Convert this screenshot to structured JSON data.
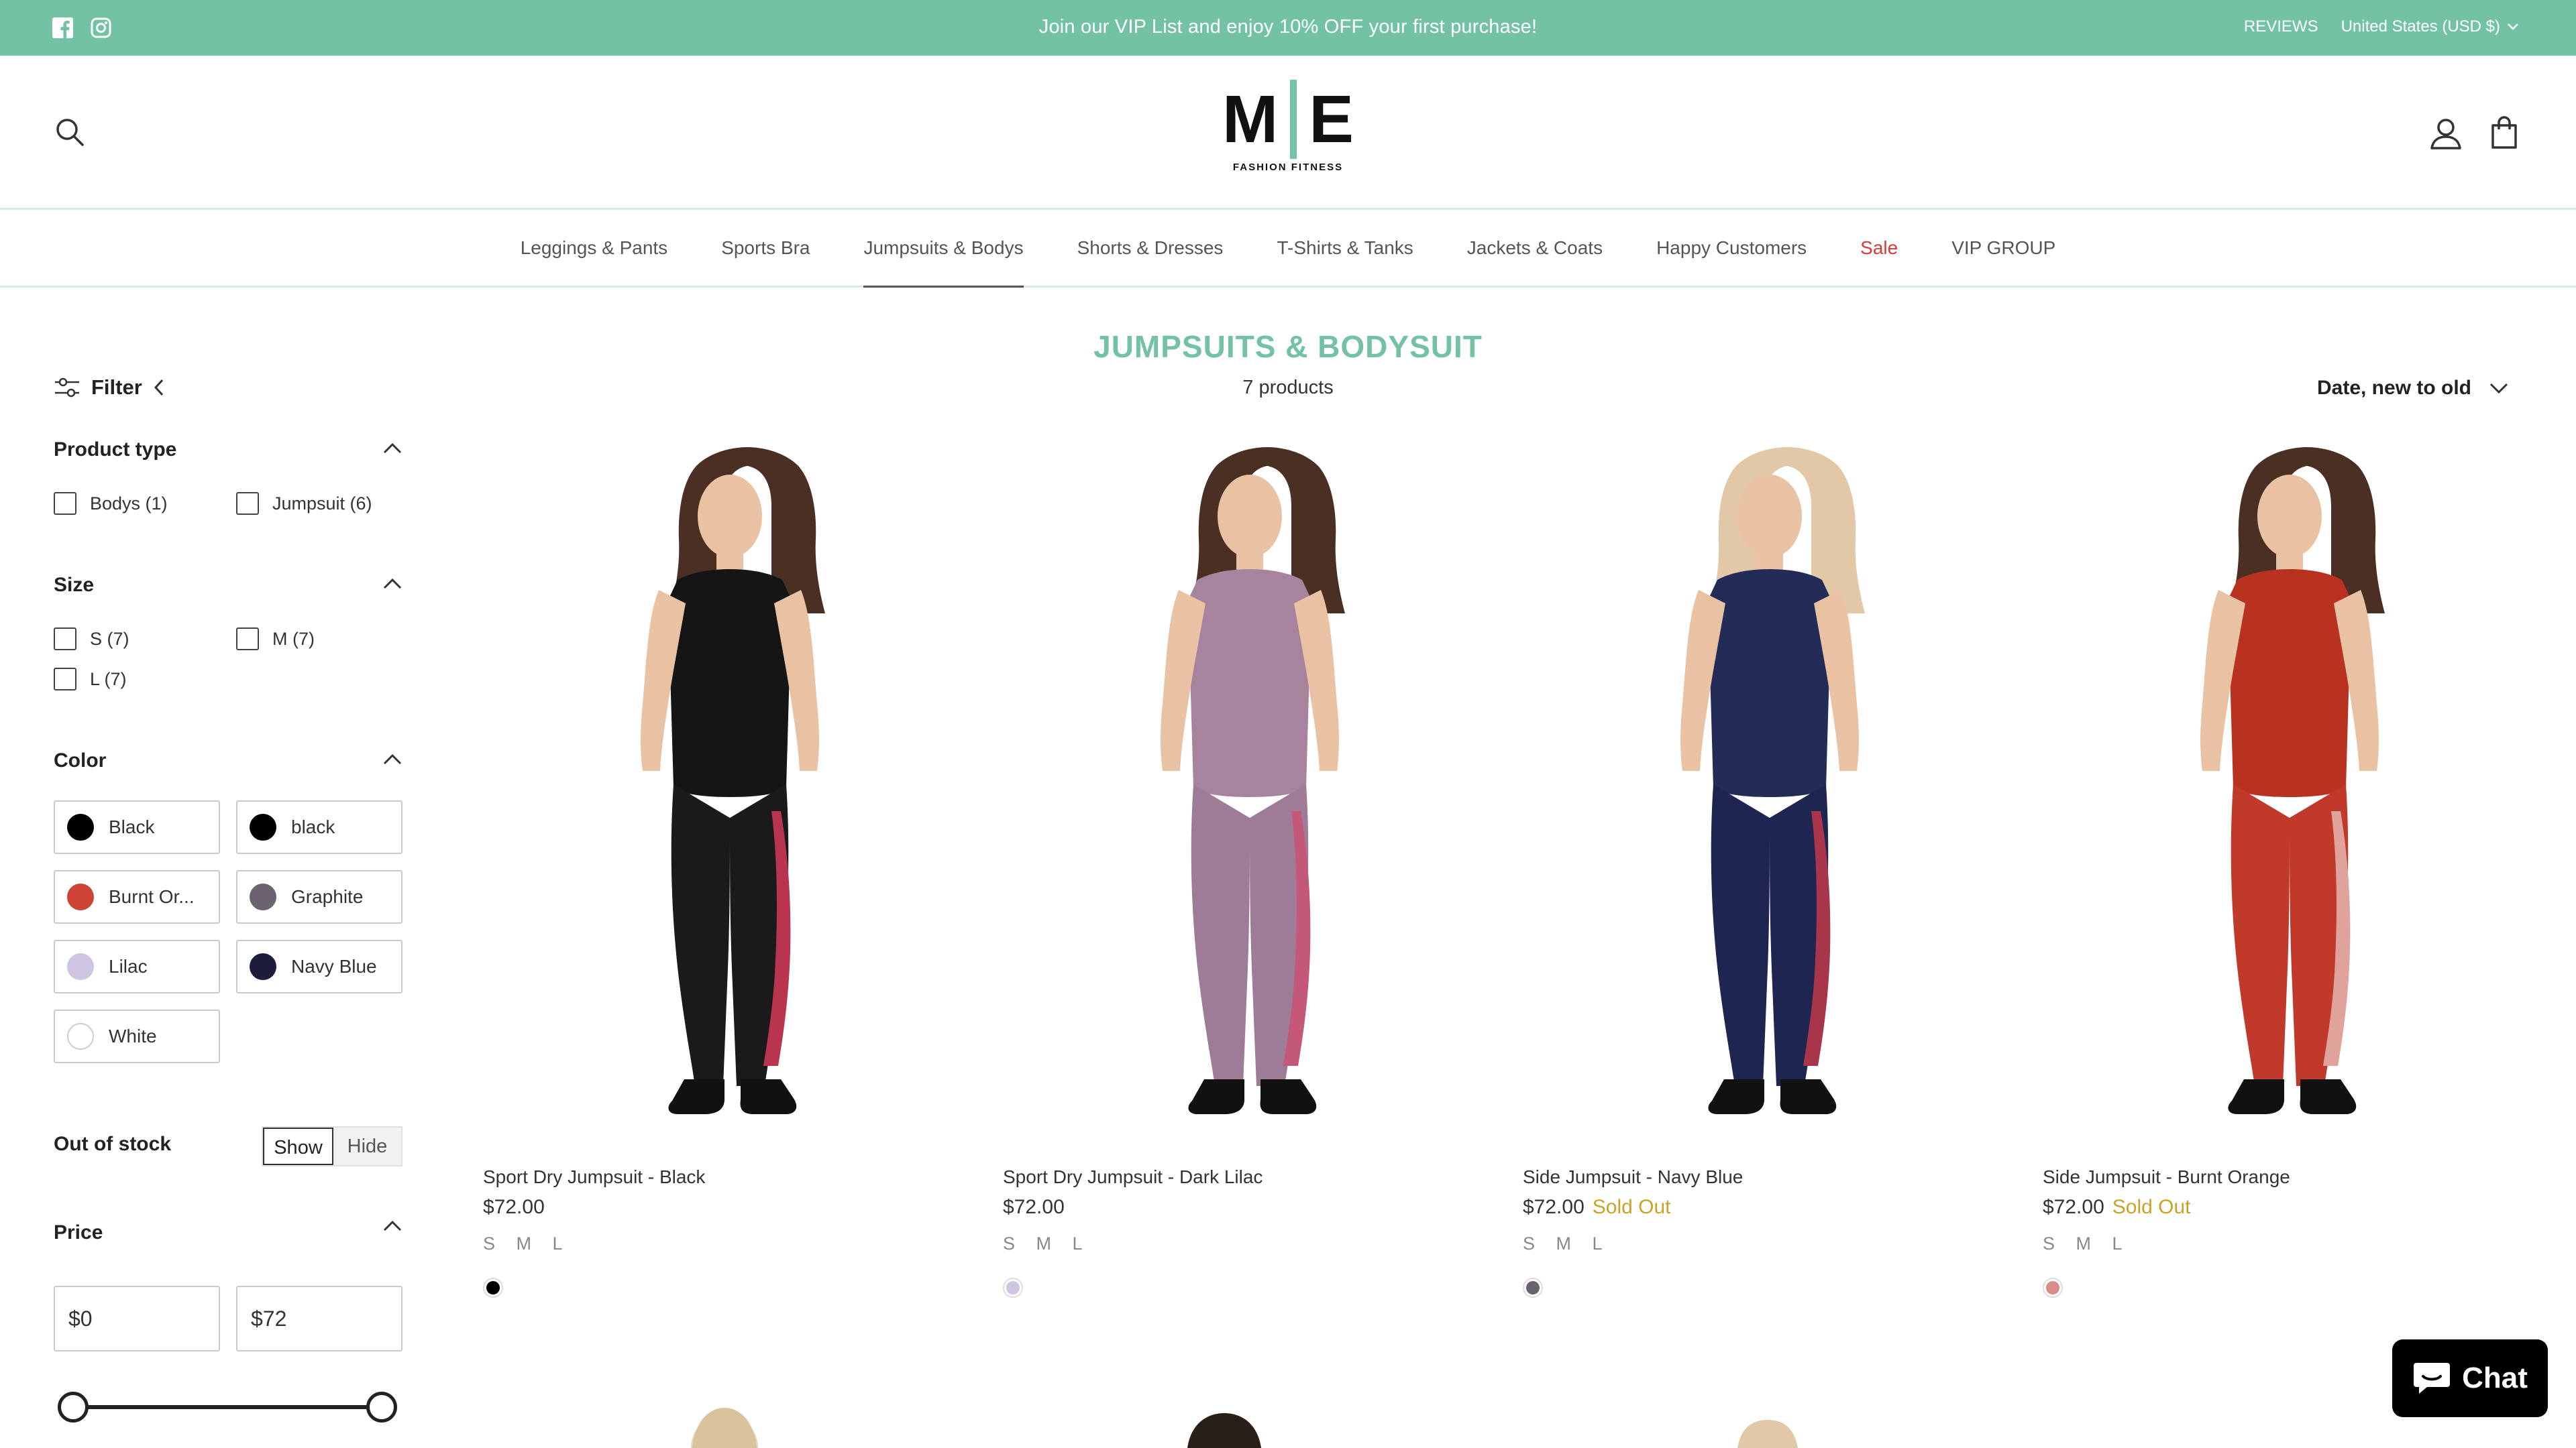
{
  "announcement": {
    "message": "Join our VIP List and enjoy 10% OFF your first purchase!",
    "reviews": "REVIEWS",
    "currency": "United States (USD $)",
    "icons": [
      "facebook-icon",
      "instagram-icon"
    ]
  },
  "header": {
    "logo_mark": "M E",
    "logo_left": "M",
    "logo_right": "E",
    "logo_tagline": "FASHION FITNESS"
  },
  "nav": {
    "items": [
      "Leggings & Pants",
      "Sports Bra",
      "Jumpsuits & Bodys",
      "Shorts & Dresses",
      "T-Shirts & Tanks",
      "Jackets & Coats",
      "Happy Customers",
      "Sale",
      "VIP GROUP"
    ],
    "active": "Jumpsuits & Bodys"
  },
  "filter": {
    "label": "Filter",
    "product_type": {
      "title": "Product type",
      "options": [
        "Bodys (1)",
        "Jumpsuit (6)"
      ]
    },
    "size": {
      "title": "Size",
      "options": [
        "S (7)",
        "M (7)",
        "L (7)"
      ]
    },
    "color": {
      "title": "Color",
      "options": [
        {
          "label": "Black",
          "hex": "#000000"
        },
        {
          "label": "black",
          "hex": "#000000"
        },
        {
          "label": "Burnt Or...",
          "hex": "#cd4336"
        },
        {
          "label": "Graphite",
          "hex": "#6b6470"
        },
        {
          "label": "Lilac",
          "hex": "#cdc5e2"
        },
        {
          "label": "Navy Blue",
          "hex": "#1d1c3d"
        },
        {
          "label": "White",
          "hex": "#ffffff"
        }
      ]
    },
    "out_of_stock": {
      "title": "Out of stock",
      "show": "Show",
      "hide": "Hide",
      "selected": "Show"
    },
    "price": {
      "title": "Price",
      "min": "0",
      "max": "72",
      "currency_symbol": "$",
      "range_min": 0,
      "range_max": 72
    }
  },
  "collection": {
    "title": "JUMPSUITS & BODYSUIT",
    "count": "7 products",
    "sort": "Date, new to old"
  },
  "products": [
    {
      "name": "Sport Dry Jumpsuit - Black",
      "price": "$72.00",
      "sold_out": "",
      "sizes": "S M L",
      "swatch": "#000000",
      "top_color": "#151515",
      "bottom_color": "#1a1a1a",
      "accent": "#b8344f"
    },
    {
      "name": "Sport Dry Jumpsuit - Dark Lilac",
      "price": "$72.00",
      "sold_out": "",
      "sizes": "S M L",
      "swatch": "#cdc5e2",
      "top_color": "#a7839d",
      "bottom_color": "#9e7b96",
      "accent": "#c45878"
    },
    {
      "name": "Side Jumpsuit - Navy Blue",
      "price": "$72.00",
      "sold_out": "Sold Out",
      "sizes": "S M L",
      "swatch": "#6b6470",
      "top_color": "#232b57",
      "bottom_color": "#1e2550",
      "accent": "#a83549"
    },
    {
      "name": "Side Jumpsuit - Burnt Orange",
      "price": "$72.00",
      "sold_out": "Sold Out",
      "sizes": "S M L",
      "swatch": "#d98c88",
      "top_color": "#b8321f",
      "bottom_color": "#c0392a",
      "accent": "#e0a39c"
    }
  ],
  "chat": {
    "label": "Chat"
  },
  "colors": {
    "brand": "#73c2a3",
    "sale": "#d43c33",
    "sold_out": "#c9a227"
  }
}
